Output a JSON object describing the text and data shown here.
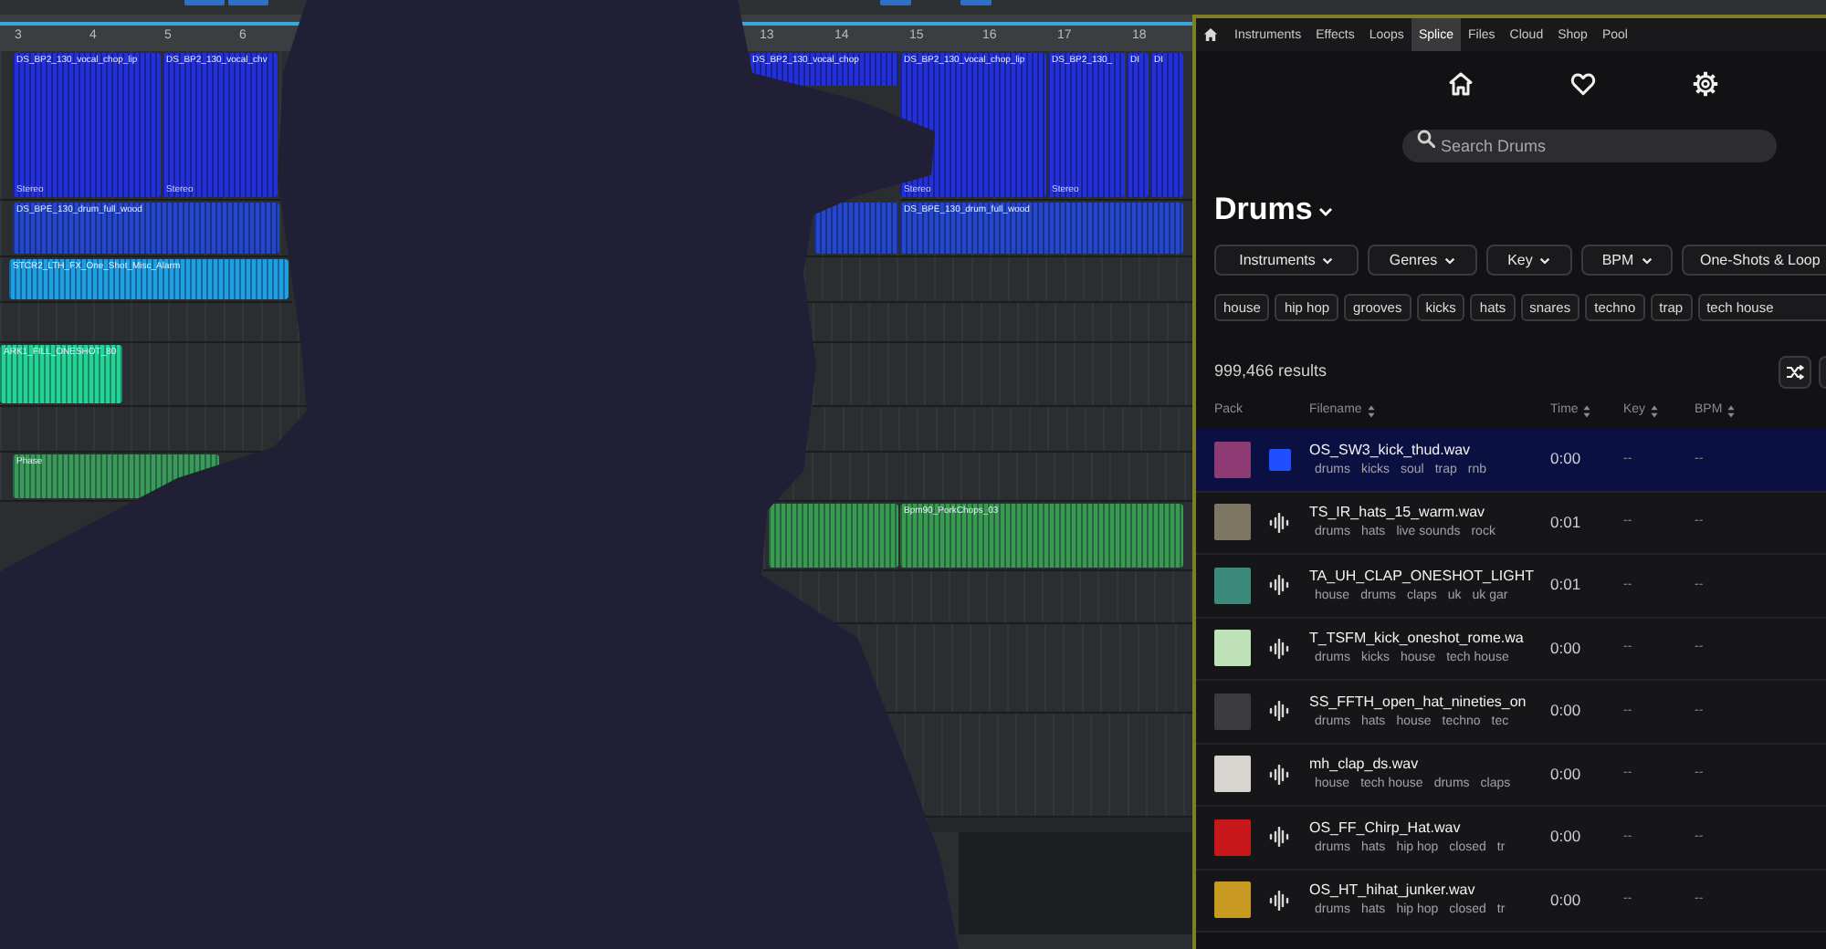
{
  "daw": {
    "ruler": [
      "3",
      "4",
      "5",
      "6",
      "13",
      "14",
      "15",
      "16",
      "17",
      "18"
    ],
    "tracks": [
      {
        "color": "#2331d6",
        "clips": [
          {
            "name": "DS_BP2_130_vocal_chop_lip",
            "footer": "Stereo"
          },
          {
            "name": "DS_BP2_130_vocal_chv",
            "footer": "Stereo"
          },
          {
            "name": "DS_BP2_130_vocal_chop"
          },
          {
            "name": "DS_BP2_130_vocal_chop_lip",
            "footer": "Stereo"
          },
          {
            "name": "DS_BP2_130_",
            "footer": "Stereo"
          },
          {
            "name": "DI"
          },
          {
            "name": "DI"
          }
        ]
      },
      {
        "color": "#2547c9",
        "clips": [
          {
            "name": "DS_BPE_130_drum_full_wood"
          },
          {
            "name": "DS_BPE_130_drum_full_wood"
          }
        ]
      },
      {
        "color": "#1f9fe0",
        "clips": [
          {
            "name": "STCR2_LTH_FX_One_Shot_Misc_Alarm"
          }
        ]
      },
      {
        "color": "#25d393",
        "clips": [
          {
            "name": "ARK1_FILL_ONESHOT_80"
          }
        ]
      },
      {
        "color": "#3b9a57",
        "clips": [
          {
            "name": "Phase"
          }
        ]
      },
      {
        "color": "#3a9a4f",
        "clips": [
          {
            "name": "Bpm90_PorkChops_03"
          }
        ]
      }
    ]
  },
  "browser": {
    "tabs": [
      {
        "label": "Instruments",
        "selected": false
      },
      {
        "label": "Effects",
        "selected": false
      },
      {
        "label": "Loops",
        "selected": false
      },
      {
        "label": "Splice",
        "selected": true
      },
      {
        "label": "Files",
        "selected": false
      },
      {
        "label": "Cloud",
        "selected": false
      },
      {
        "label": "Shop",
        "selected": false
      },
      {
        "label": "Pool",
        "selected": false
      }
    ],
    "search": {
      "placeholder": "Search Drums"
    },
    "heading": "Drums",
    "filters": [
      "Instruments",
      "Genres",
      "Key",
      "BPM",
      "One-Shots & Loop"
    ],
    "tags": [
      "house",
      "hip hop",
      "grooves",
      "kicks",
      "hats",
      "snares",
      "techno",
      "trap",
      "tech house"
    ],
    "result_count": "999,466 results",
    "columns": [
      {
        "label": "Pack",
        "sortable": false
      },
      {
        "label": "Filename",
        "sortable": true
      },
      {
        "label": "Time",
        "sortable": true
      },
      {
        "label": "Key",
        "sortable": true
      },
      {
        "label": "BPM",
        "sortable": true
      }
    ],
    "rows": [
      {
        "filename": "OS_SW3_kick_thud.wav",
        "tags": [
          "drums",
          "kicks",
          "soul",
          "trap",
          "rnb"
        ],
        "time": "0:00",
        "key": "--",
        "bpm": "--",
        "selected": true
      },
      {
        "filename": "TS_IR_hats_15_warm.wav",
        "tags": [
          "drums",
          "hats",
          "live sounds",
          "rock"
        ],
        "time": "0:01",
        "key": "--",
        "bpm": "--",
        "selected": false
      },
      {
        "filename": "TA_UH_CLAP_ONESHOT_LIGHT",
        "tags": [
          "house",
          "drums",
          "claps",
          "uk",
          "uk gar"
        ],
        "time": "0:01",
        "key": "--",
        "bpm": "--",
        "selected": false
      },
      {
        "filename": "T_TSFM_kick_oneshot_rome.wa",
        "tags": [
          "drums",
          "kicks",
          "house",
          "tech house"
        ],
        "time": "0:00",
        "key": "--",
        "bpm": "--",
        "selected": false
      },
      {
        "filename": "SS_FFTH_open_hat_nineties_on",
        "tags": [
          "drums",
          "hats",
          "house",
          "techno",
          "tec"
        ],
        "time": "0:00",
        "key": "--",
        "bpm": "--",
        "selected": false
      },
      {
        "filename": "mh_clap_ds.wav",
        "tags": [
          "house",
          "tech house",
          "drums",
          "claps"
        ],
        "time": "0:00",
        "key": "--",
        "bpm": "--",
        "selected": false
      },
      {
        "filename": "OS_FF_Chirp_Hat.wav",
        "tags": [
          "drums",
          "hats",
          "hip hop",
          "closed",
          "tr"
        ],
        "time": "0:00",
        "key": "--",
        "bpm": "--",
        "selected": false
      },
      {
        "filename": "OS_HT_hihat_junker.wav",
        "tags": [
          "drums",
          "hats",
          "hip hop",
          "closed",
          "tr"
        ],
        "time": "0:00",
        "key": "--",
        "bpm": "--",
        "selected": false
      }
    ]
  }
}
